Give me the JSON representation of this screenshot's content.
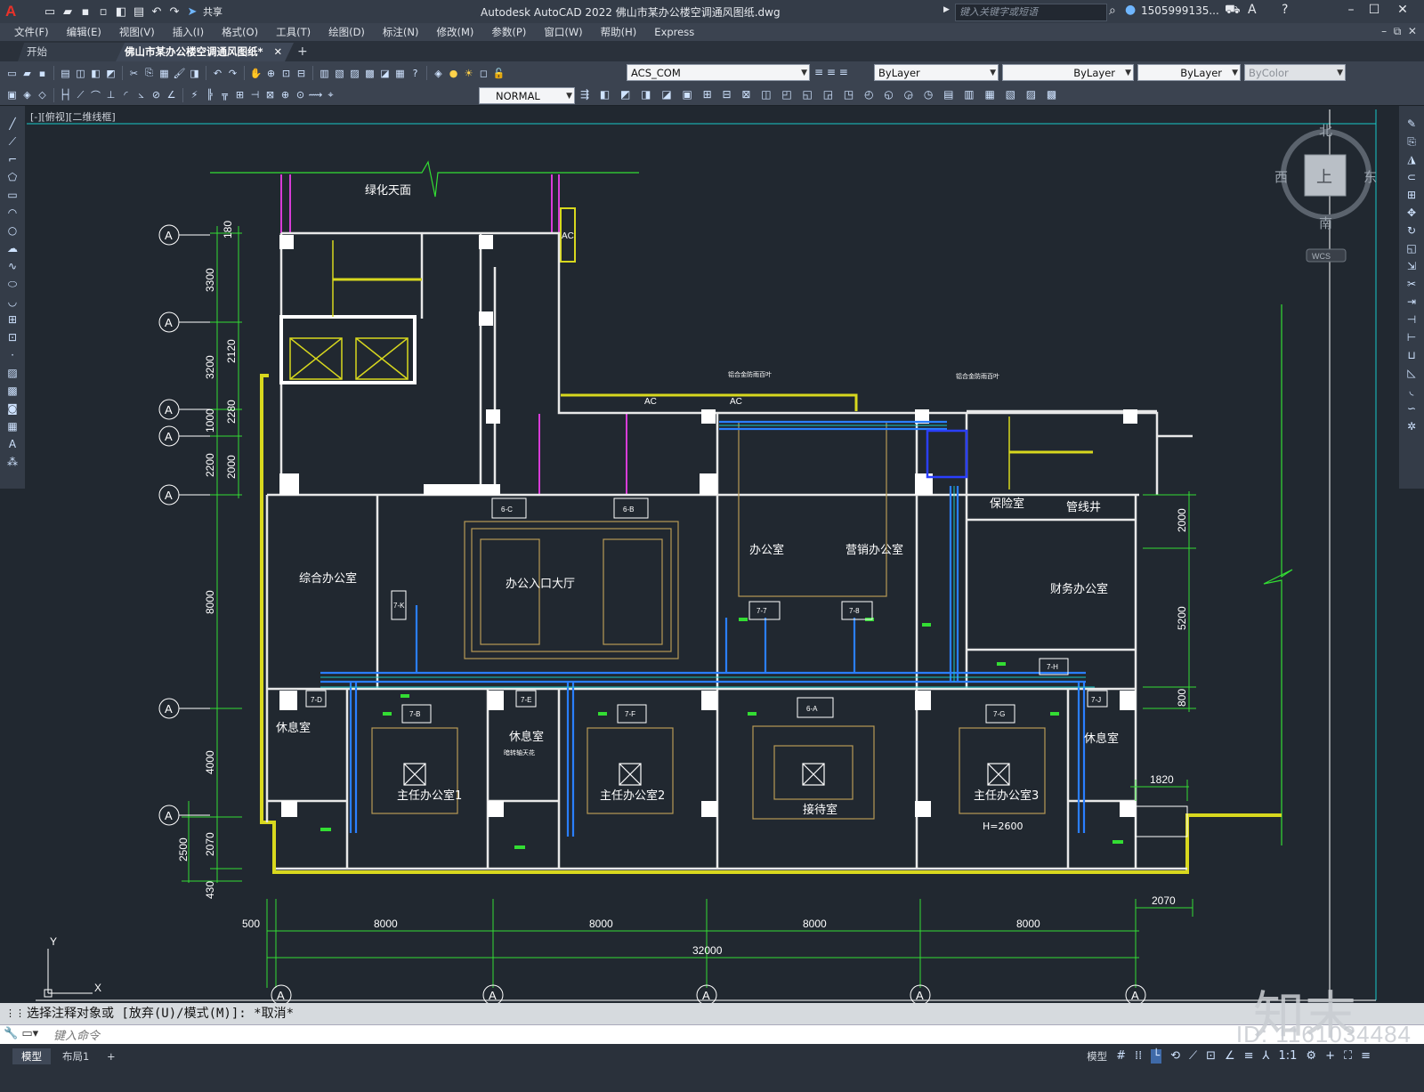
{
  "app": {
    "title": "Autodesk AutoCAD 2022    佛山市某办公楼空调通风图纸.dwg",
    "search_placeholder": "键入关键字或短语",
    "user": "1505999135...",
    "share_label": "共享",
    "logo": "A"
  },
  "menu": [
    "文件(F)",
    "编辑(E)",
    "视图(V)",
    "插入(I)",
    "格式(O)",
    "工具(T)",
    "绘图(D)",
    "标注(N)",
    "修改(M)",
    "参数(P)",
    "窗口(W)",
    "帮助(H)",
    "Express"
  ],
  "tabs": {
    "start": "开始",
    "active": "佛山市某办公楼空调通风图纸*",
    "close": "✕",
    "add": "+"
  },
  "toolbar": {
    "layer": "ACS_COM",
    "color": "ByLayer",
    "linetype": "ByLayer",
    "lineweight": "ByLayer",
    "plotstyle": "ByColor",
    "dimstyle": "NORMAL"
  },
  "viewport_label": "[-][俯视][二维线框]",
  "viewcube": {
    "north": "北",
    "south": "南",
    "east": "东",
    "west": "西",
    "top": "上",
    "wcs": "WCS"
  },
  "drawing": {
    "rooms": {
      "roof_garden": "绿化天面",
      "general_office": "综合办公室",
      "lobby": "办公入口大厅",
      "office": "办公室",
      "marketing": "营销办公室",
      "finance": "财务办公室",
      "safe_room": "保险室",
      "pipe_shaft": "管线井",
      "rest1": "休息室",
      "rest2": "休息室",
      "rest3": "休息室",
      "director1": "主任办公室1",
      "director2": "主任办公室2",
      "director3": "主任办公室3",
      "reception": "接待室",
      "height_note": "H=2600",
      "rest2_note": "暗转轴天花"
    },
    "ac_labels": [
      "AC",
      "AC",
      "AC"
    ],
    "unit_tags": [
      "6-C",
      "6-B",
      "7-7",
      "7-8",
      "7-B",
      "7-D",
      "7-E",
      "6-A",
      "7-F",
      "7-G",
      "7-H",
      "7-J",
      "7-K"
    ],
    "left_dims": [
      "180",
      "3300",
      "3200",
      "2120",
      "2280",
      "1000",
      "2200",
      "2000",
      "8000",
      "4000",
      "2500",
      "2070",
      "430"
    ],
    "right_dims": [
      "2000",
      "5200",
      "800",
      "1820"
    ],
    "bottom_dims": [
      "500",
      "8000",
      "8000",
      "8000",
      "8000",
      "32000",
      "2070"
    ],
    "axis_label": "A",
    "ucs": {
      "x": "X",
      "y": "Y"
    },
    "duct_notes": [
      "铝合金防雨百叶",
      "铝合金防雨百叶"
    ]
  },
  "command": {
    "history": "选择注释对象或 [放弃(U)/模式(M)]: *取消*",
    "placeholder": "键入命令"
  },
  "status": {
    "model_tab": "模型",
    "layout_tab": "布局1",
    "add_tab": "+",
    "model_button": "模型",
    "scale": "1:1"
  },
  "watermark": {
    "id": "ID: 1161034484",
    "logo": "知末"
  }
}
